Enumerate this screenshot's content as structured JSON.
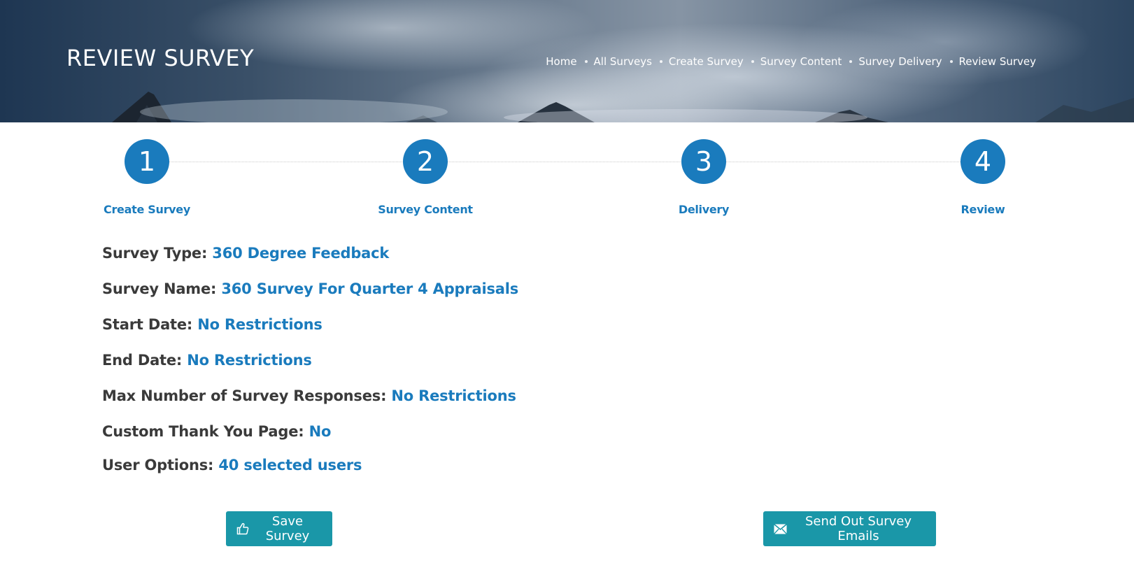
{
  "header": {
    "title": "REVIEW SURVEY",
    "breadcrumb": [
      "Home",
      "All Surveys",
      "Create Survey",
      "Survey Content",
      "Survey Delivery",
      "Review Survey"
    ]
  },
  "steps": [
    {
      "number": "1",
      "label": "Create Survey"
    },
    {
      "number": "2",
      "label": "Survey Content"
    },
    {
      "number": "3",
      "label": "Delivery"
    },
    {
      "number": "4",
      "label": "Review"
    }
  ],
  "details": [
    {
      "label": "Survey Type:",
      "value": "360 Degree Feedback"
    },
    {
      "label": "Survey Name:",
      "value": "360 Survey For Quarter 4 Appraisals"
    },
    {
      "label": "Start Date:",
      "value": "No Restrictions"
    },
    {
      "label": "End Date:",
      "value": "No Restrictions"
    },
    {
      "label": "Max Number of Survey Responses:",
      "value": "No Restrictions"
    },
    {
      "label": "Custom Thank You Page:",
      "value": "No"
    },
    {
      "label": "User Options:",
      "value": "40 selected users"
    }
  ],
  "actions": {
    "save_label": "Save Survey",
    "save_icon": "thumbs-up-icon",
    "send_label": "Send Out Survey Emails",
    "send_icon": "envelope-icon"
  },
  "colors": {
    "accent": "#1a7bbd",
    "button": "#1a97a8",
    "label_text": "#3a3a3a"
  }
}
